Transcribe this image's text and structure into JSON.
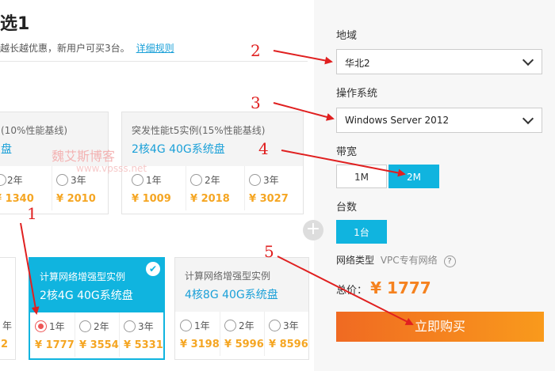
{
  "header": {
    "title": "选1",
    "subtitle": "越长越优惠，新用户可买3台。",
    "link": "详细规则"
  },
  "cards_row1": [
    {
      "type": "(10%性能基线)",
      "spec": "盘",
      "options": [
        {
          "label": "2年",
          "price": "¥ 1340"
        },
        {
          "label": "3年",
          "price": "¥ 2010"
        }
      ]
    },
    {
      "type": "突发性能t5实例(15%性能基线)",
      "spec": "2核4G 40G系统盘",
      "options": [
        {
          "label": "1年",
          "price": "¥ 1009"
        },
        {
          "label": "2年",
          "price": "¥ 2018"
        },
        {
          "label": "3年",
          "price": "¥ 3027"
        }
      ]
    }
  ],
  "cards_row2": [
    {
      "type": "",
      "spec": "",
      "options": [
        {
          "label": "年",
          "price": "2"
        }
      ]
    },
    {
      "type": "计算网络增强型实例",
      "spec": "2核4G 40G系统盘",
      "selected": true,
      "options": [
        {
          "label": "1年",
          "price": "¥ 1777",
          "checked": true
        },
        {
          "label": "2年",
          "price": "¥ 3554"
        },
        {
          "label": "3年",
          "price": "¥ 5331"
        }
      ]
    },
    {
      "type": "计算网络增强型实例",
      "spec": "4核8G 40G系统盘",
      "options": [
        {
          "label": "1年",
          "price": "¥ 3198"
        },
        {
          "label": "2年",
          "price": "¥ 5996"
        },
        {
          "label": "3年",
          "price": "¥ 8596"
        }
      ]
    }
  ],
  "panel": {
    "region_label": "地域",
    "region_value": "华北2",
    "os_label": "操作系统",
    "os_value": "Windows Server 2012",
    "bandwidth_label": "带宽",
    "bandwidth_options": [
      "1M",
      "2M"
    ],
    "count_label": "台数",
    "count_value": "1台",
    "network_label": "网络类型",
    "network_value": "VPC专有网络",
    "total_label": "总价：",
    "total_value": "¥ 1777",
    "buy_label": "立即购买"
  },
  "annotations": [
    "1",
    "2",
    "3",
    "4",
    "5"
  ],
  "watermark": {
    "title": "魏艾斯博客",
    "url": "www.vpsss.net"
  },
  "colors": {
    "accent": "#10b4df",
    "price": "#f5a623",
    "buy": "#f5821f",
    "annotation": "#e02020"
  }
}
